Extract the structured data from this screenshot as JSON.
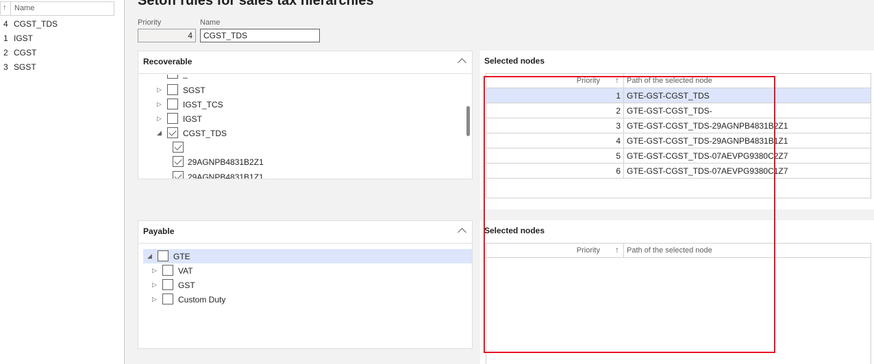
{
  "left_list": {
    "header_sort_icon": "↑",
    "header_label": "Name",
    "rows": [
      {
        "priority": "4",
        "name": "CGST_TDS"
      },
      {
        "priority": "1",
        "name": "IGST"
      },
      {
        "priority": "2",
        "name": "CGST"
      },
      {
        "priority": "3",
        "name": "SGST"
      }
    ]
  },
  "page_title": "Setoff rules for sales tax hierarchies",
  "fields": {
    "priority_label": "Priority",
    "priority_value": "4",
    "name_label": "Name",
    "name_value": "CGST_TDS"
  },
  "recoverable": {
    "title": "Recoverable",
    "nodes": [
      {
        "label": "_",
        "expander": "",
        "checked": false
      },
      {
        "label": "SGST",
        "expander": "▷",
        "checked": false
      },
      {
        "label": "IGST_TCS",
        "expander": "▷",
        "checked": false
      },
      {
        "label": "IGST",
        "expander": "▷",
        "checked": false
      },
      {
        "label": "CGST_TDS",
        "expander": "◢",
        "checked": true
      },
      {
        "label": "",
        "expander": "",
        "checked": true
      },
      {
        "label": "29AGNPB4831B2Z1",
        "expander": "",
        "checked": true
      },
      {
        "label": "29AGNPB4831B1Z1",
        "expander": "",
        "checked": true
      }
    ]
  },
  "selected_nodes_top": {
    "title": "Selected nodes",
    "col_priority": "Priority",
    "col_path": "Path of the selected node",
    "sort_icon": "↑",
    "rows": [
      {
        "priority": "1",
        "path": "GTE-GST-CGST_TDS"
      },
      {
        "priority": "2",
        "path": "GTE-GST-CGST_TDS-"
      },
      {
        "priority": "3",
        "path": "GTE-GST-CGST_TDS-29AGNPB4831B2Z1"
      },
      {
        "priority": "4",
        "path": "GTE-GST-CGST_TDS-29AGNPB4831B1Z1"
      },
      {
        "priority": "5",
        "path": "GTE-GST-CGST_TDS-07AEVPG9380C2Z7"
      },
      {
        "priority": "6",
        "path": "GTE-GST-CGST_TDS-07AEVPG9380C1Z7"
      }
    ]
  },
  "payable": {
    "title": "Payable",
    "nodes": [
      {
        "label": "GTE",
        "expander": "◢",
        "checked": false
      },
      {
        "label": "VAT",
        "expander": "▷",
        "checked": false
      },
      {
        "label": "GST",
        "expander": "▷",
        "checked": false
      },
      {
        "label": "Custom Duty",
        "expander": "▷",
        "checked": false
      }
    ]
  },
  "selected_nodes_bottom": {
    "title": "Selected nodes",
    "col_priority": "Priority",
    "col_path": "Path of the selected node",
    "sort_icon": "↑"
  },
  "colors": {
    "selection": "#dce5fb",
    "highlight_annotation": "#e81123"
  }
}
